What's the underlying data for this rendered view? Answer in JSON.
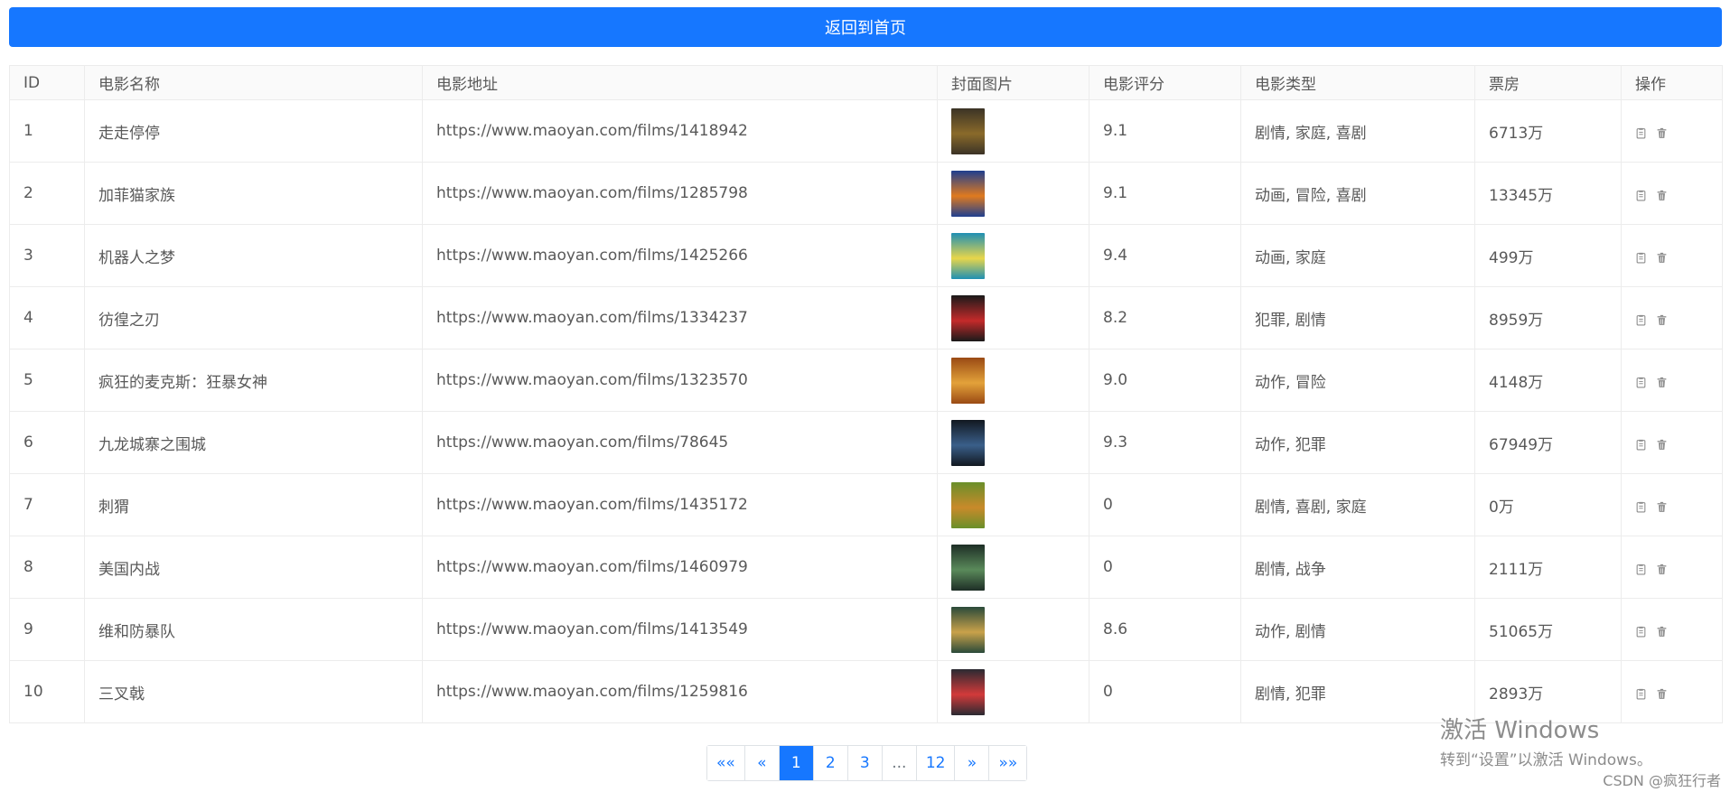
{
  "back_button": {
    "label": "返回到首页"
  },
  "table": {
    "headers": [
      "ID",
      "电影名称",
      "电影地址",
      "封面图片",
      "电影评分",
      "电影类型",
      "票房",
      "操作"
    ],
    "rows": [
      {
        "id": "1",
        "name": "走走停停",
        "url": "https://www.maoyan.com/films/1418942",
        "score": "9.1",
        "type": "剧情, 家庭, 喜剧",
        "box_office": "6713万",
        "poster_colors": [
          "#3b3326",
          "#8a6a2a"
        ]
      },
      {
        "id": "2",
        "name": "加菲猫家族",
        "url": "https://www.maoyan.com/films/1285798",
        "score": "9.1",
        "type": "动画, 冒险, 喜剧",
        "box_office": "13345万",
        "poster_colors": [
          "#1f3f8f",
          "#e07a1f"
        ]
      },
      {
        "id": "3",
        "name": "机器人之梦",
        "url": "https://www.maoyan.com/films/1425266",
        "score": "9.4",
        "type": "动画, 家庭",
        "box_office": "499万",
        "poster_colors": [
          "#1f8fb3",
          "#e8d64a"
        ]
      },
      {
        "id": "4",
        "name": "彷徨之刃",
        "url": "https://www.maoyan.com/films/1334237",
        "score": "8.2",
        "type": "犯罪, 剧情",
        "box_office": "8959万",
        "poster_colors": [
          "#1a1a1a",
          "#c42a2a"
        ]
      },
      {
        "id": "5",
        "name": "疯狂的麦克斯：狂暴女神",
        "url": "https://www.maoyan.com/films/1323570",
        "score": "9.0",
        "type": "动作, 冒险",
        "box_office": "4148万",
        "poster_colors": [
          "#9a4a14",
          "#e3a23a"
        ]
      },
      {
        "id": "6",
        "name": "九龙城寨之围城",
        "url": "https://www.maoyan.com/films/78645",
        "score": "9.3",
        "type": "动作, 犯罪",
        "box_office": "67949万",
        "poster_colors": [
          "#121820",
          "#3a5f8a"
        ]
      },
      {
        "id": "7",
        "name": "刺猬",
        "url": "https://www.maoyan.com/films/1435172",
        "score": "0",
        "type": "剧情, 喜剧, 家庭",
        "box_office": "0万",
        "poster_colors": [
          "#6a8f2a",
          "#c98a2a"
        ]
      },
      {
        "id": "8",
        "name": "美国内战",
        "url": "https://www.maoyan.com/films/1460979",
        "score": "0",
        "type": "剧情, 战争",
        "box_office": "2111万",
        "poster_colors": [
          "#1e2e26",
          "#5a8a5a"
        ]
      },
      {
        "id": "9",
        "name": "维和防暴队",
        "url": "https://www.maoyan.com/films/1413549",
        "score": "8.6",
        "type": "动作, 剧情",
        "box_office": "51065万",
        "poster_colors": [
          "#2a4a3a",
          "#c9a24a"
        ]
      },
      {
        "id": "10",
        "name": "三叉戟",
        "url": "https://www.maoyan.com/films/1259816",
        "score": "0",
        "type": "剧情, 犯罪",
        "box_office": "2893万",
        "poster_colors": [
          "#2a2a32",
          "#d23a3a"
        ]
      }
    ]
  },
  "pagination": {
    "items": [
      {
        "label": "««",
        "active": false
      },
      {
        "label": "«",
        "active": false
      },
      {
        "label": "1",
        "active": true
      },
      {
        "label": "2",
        "active": false
      },
      {
        "label": "3",
        "active": false
      },
      {
        "label": "...",
        "active": false
      },
      {
        "label": "12",
        "active": false
      },
      {
        "label": "»",
        "active": false
      },
      {
        "label": "»»",
        "active": false
      }
    ]
  },
  "watermark": {
    "title": "激活 Windows",
    "subtitle": "转到“设置”以激活 Windows。"
  },
  "footer": {
    "credit": "CSDN @疯狂行者"
  },
  "colors": {
    "primary": "#1677ff",
    "border": "#ececec",
    "header_bg": "#fafafa",
    "text": "#595959"
  },
  "icons": {
    "edit": "edit-icon",
    "delete": "delete-icon"
  }
}
